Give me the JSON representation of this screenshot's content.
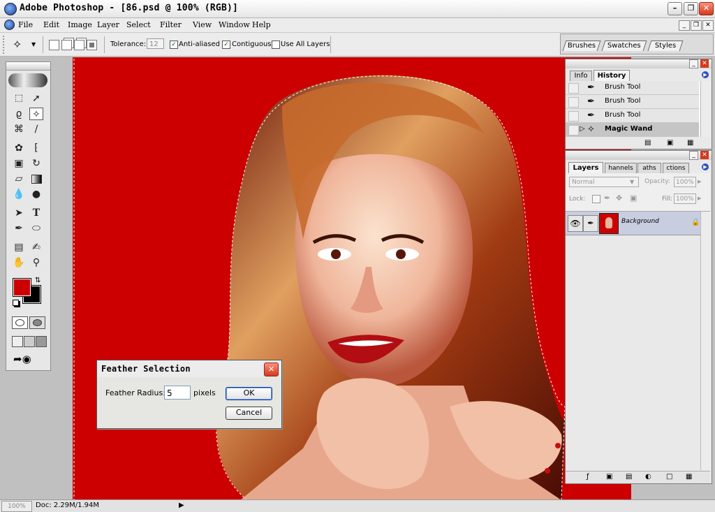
{
  "app": {
    "window_title": "Adobe Photoshop - [86.psd @ 100% (RGB)]"
  },
  "menu": [
    "File",
    "Edit",
    "Image",
    "Layer",
    "Select",
    "Filter",
    "View",
    "Window",
    "Help"
  ],
  "options_bar": {
    "tolerance_label": "Tolerance:",
    "tolerance_value": "12",
    "anti_aliased_label": "Anti-aliased",
    "anti_aliased_checked": true,
    "contiguous_label": "Contiguous",
    "contiguous_checked": true,
    "use_all_layers_label": "Use All Layers",
    "use_all_layers_checked": false
  },
  "palette_well": {
    "tabs": [
      "Brushes",
      "Swatches",
      "Styles"
    ]
  },
  "history_panel": {
    "tabs": [
      "Info",
      "History"
    ],
    "active_tab": "History",
    "states": [
      {
        "label": "Brush Tool",
        "icon": "brush-icon",
        "selected": false
      },
      {
        "label": "Brush Tool",
        "icon": "brush-icon",
        "selected": false
      },
      {
        "label": "Brush Tool",
        "icon": "brush-icon",
        "selected": false
      },
      {
        "label": "Magic Wand",
        "icon": "magic-wand-icon",
        "selected": true
      }
    ]
  },
  "layers_panel": {
    "tabs": [
      "Layers",
      "Channels",
      "Paths",
      "Actions"
    ],
    "visible_tab_text": [
      "Layers",
      "hannels",
      "aths",
      "ctions"
    ],
    "blend_mode": "Normal",
    "opacity_label": "Opacity:",
    "opacity_value": "100%",
    "lock_label": "Lock:",
    "fill_label": "Fill:",
    "fill_value": "100%",
    "layers": [
      {
        "name": "Background",
        "visible": true,
        "locked": true
      }
    ]
  },
  "feather_dialog": {
    "title": "Feather Selection",
    "radius_label": "Feather Radius:",
    "radius_value": "5",
    "unit": "pixels",
    "ok_label": "OK",
    "cancel_label": "Cancel"
  },
  "status_bar": {
    "zoom": "100%",
    "doc_info": "Doc: 2.29M/1.94M"
  },
  "colors": {
    "foreground": "#cc0000",
    "background": "#000000",
    "canvas_bg": "#cc0000"
  }
}
